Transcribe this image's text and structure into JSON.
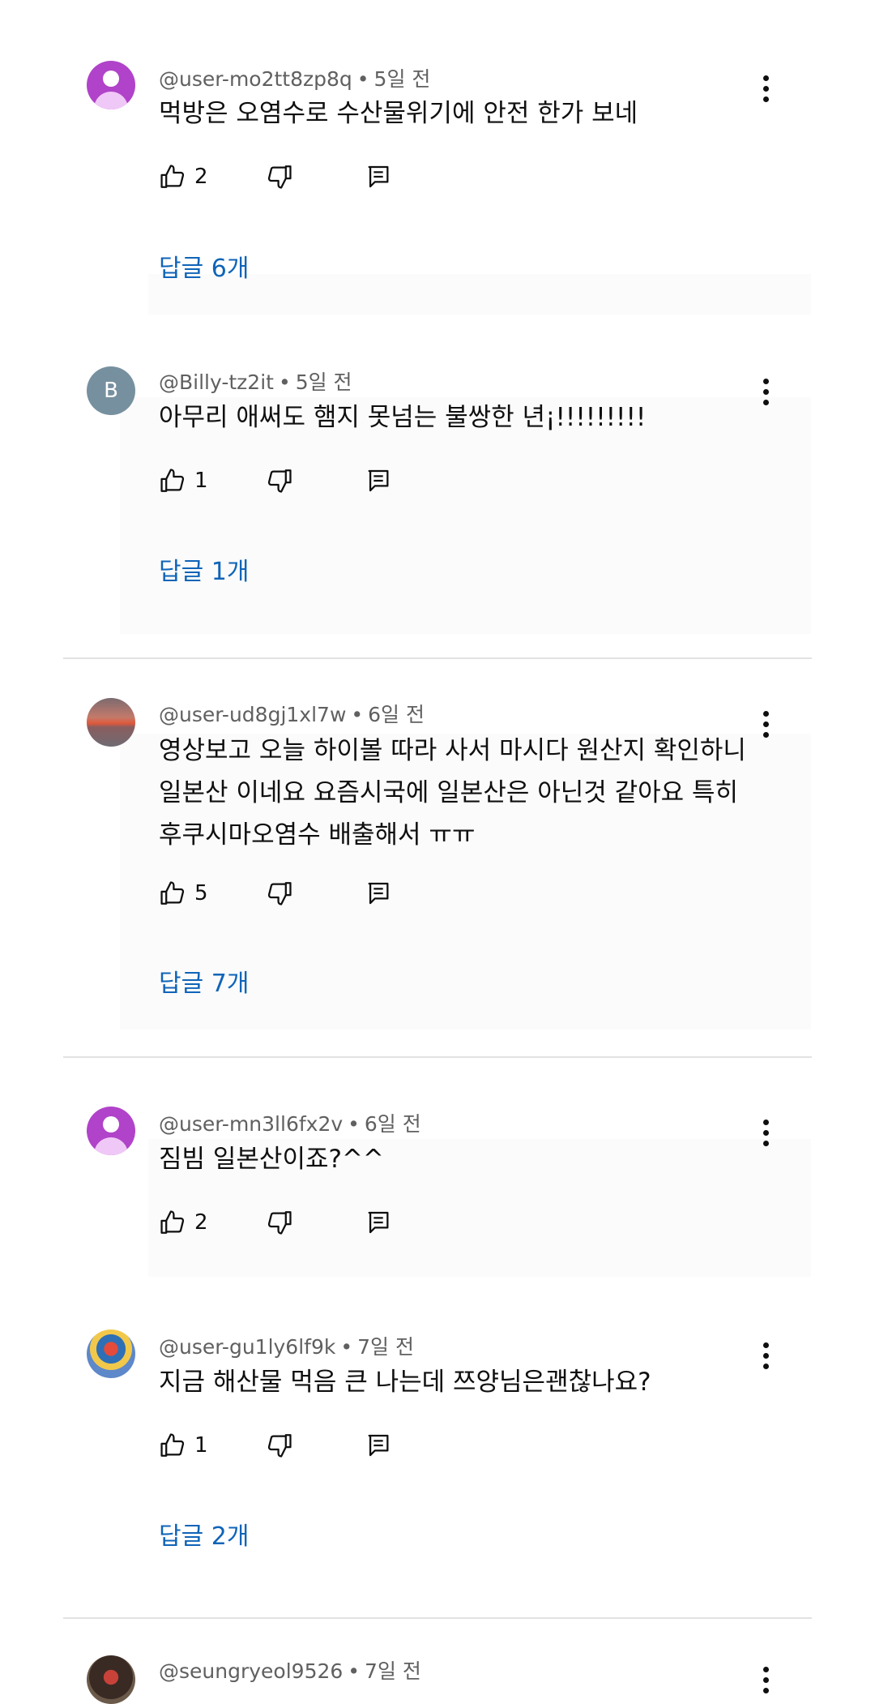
{
  "comments": [
    {
      "handle": "@user-mo2tt8zp8q",
      "time": "5일 전",
      "text": [
        "먹방은 오염수로 수산물위기에 안전 한가 보네"
      ],
      "likes": "2",
      "replies": "답글 6개",
      "avatar": "person"
    },
    {
      "handle": "@Billy-tz2it",
      "time": "5일 전",
      "text": [
        "아무리 애써도 햄지 못넘는 불쌍한 년¡!!!!!!!!!"
      ],
      "likes": "1",
      "replies": "답글 1개",
      "avatar": "letter",
      "avatar_letter": "B"
    },
    {
      "handle": "@user-ud8gj1xl7w",
      "time": "6일 전",
      "text": [
        "영상보고 오늘 하이볼 따라 사서 마시다 원산지 확인하니",
        "일본산 이네요 요즘시국에 일본산은 아닌것 같아요 특히",
        "후쿠시마오염수 배출해서 ㅠㅠ"
      ],
      "likes": "5",
      "replies": "답글 7개",
      "avatar": "sunset"
    },
    {
      "handle": "@user-mn3ll6fx2v",
      "time": "6일 전",
      "text": [
        "짐빔 일본산이죠?^^"
      ],
      "likes": "2",
      "replies": "",
      "avatar": "person"
    },
    {
      "handle": "@user-gu1ly6lf9k",
      "time": "7일 전",
      "text": [
        "지금 해산물 먹음 큰 나는데 쯔양님은괜찮나요?"
      ],
      "likes": "1",
      "replies": "답글 2개",
      "avatar": "photo"
    },
    {
      "handle": "@seungryeol9526",
      "time": "7일 전",
      "text": [],
      "likes": "",
      "replies": "",
      "avatar": "photo2"
    }
  ],
  "icons": {
    "like": "thumbs-up-icon",
    "dislike": "thumbs-down-icon",
    "reply": "reply-comment-icon",
    "menu": "more-vert-icon"
  },
  "colors": {
    "reply_link": "#0f64b8",
    "meta": "#606060"
  }
}
